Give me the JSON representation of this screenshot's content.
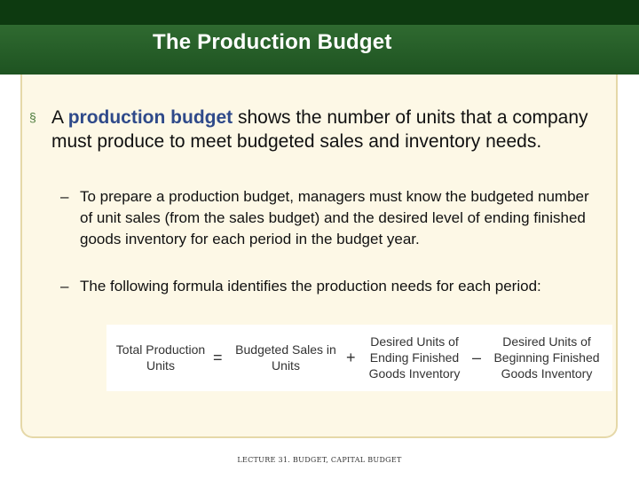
{
  "slide": {
    "title": "The Production Budget"
  },
  "bullet": {
    "marker": "§",
    "lead": "A ",
    "highlight": "production budget",
    "rest": " shows the number of units that a company must produce to meet budgeted sales and inventory needs."
  },
  "subbullets": [
    {
      "dash": "–",
      "text": "To prepare a production budget, managers must know the budgeted number of unit sales (from the sales budget) and the desired level of ending finished goods inventory for each period in the budget year."
    },
    {
      "dash": "–",
      "text": "The following formula identifies the production needs for each period:"
    }
  ],
  "formula": {
    "term1_line1": "Total Production",
    "term1_line2": "Units",
    "op_equals": "=",
    "term2_line1": "Budgeted Sales in",
    "term2_line2": "Units",
    "op_plus": "+",
    "term3_line1": "Desired Units of",
    "term3_line2": "Ending Finished",
    "term3_line3": "Goods Inventory",
    "op_minus": "–",
    "term4_line1": "Desired Units of",
    "term4_line2": "Beginning Finished",
    "term4_line3": "Goods Inventory"
  },
  "footer": {
    "text": "LECTURE 31. BUDGET, CAPITAL BUDGET"
  },
  "colors": {
    "title_bar": "#1e5321",
    "top_strip": "#0d3a10",
    "panel_bg": "#fdf8e6",
    "highlight": "#2f4a8a"
  }
}
